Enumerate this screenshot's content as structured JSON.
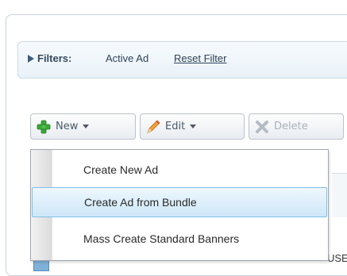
{
  "filters": {
    "label": "Filters:",
    "value": "Active Ad",
    "reset": "Reset Filter"
  },
  "toolbar": {
    "new_label": "New",
    "edit_label": "Edit",
    "delete_label": "Delete"
  },
  "menu": {
    "items": [
      {
        "label": "Create New Ad"
      },
      {
        "label": "Create Ad from Bundle",
        "highlighted": true
      },
      {
        "label": "Mass Create Standard Banners"
      }
    ]
  },
  "grid": {
    "row_partial": "USE"
  },
  "icons": {
    "filter_toggle": "triangle-right-icon",
    "new": "plus-icon",
    "edit": "pencil-icon",
    "delete": "x-icon"
  },
  "colors": {
    "menu_highlight": "#cde7f8",
    "menu_highlight_border": "#7fc0e6",
    "plus_green": "#3aa83a",
    "filter_text": "#34495e"
  }
}
